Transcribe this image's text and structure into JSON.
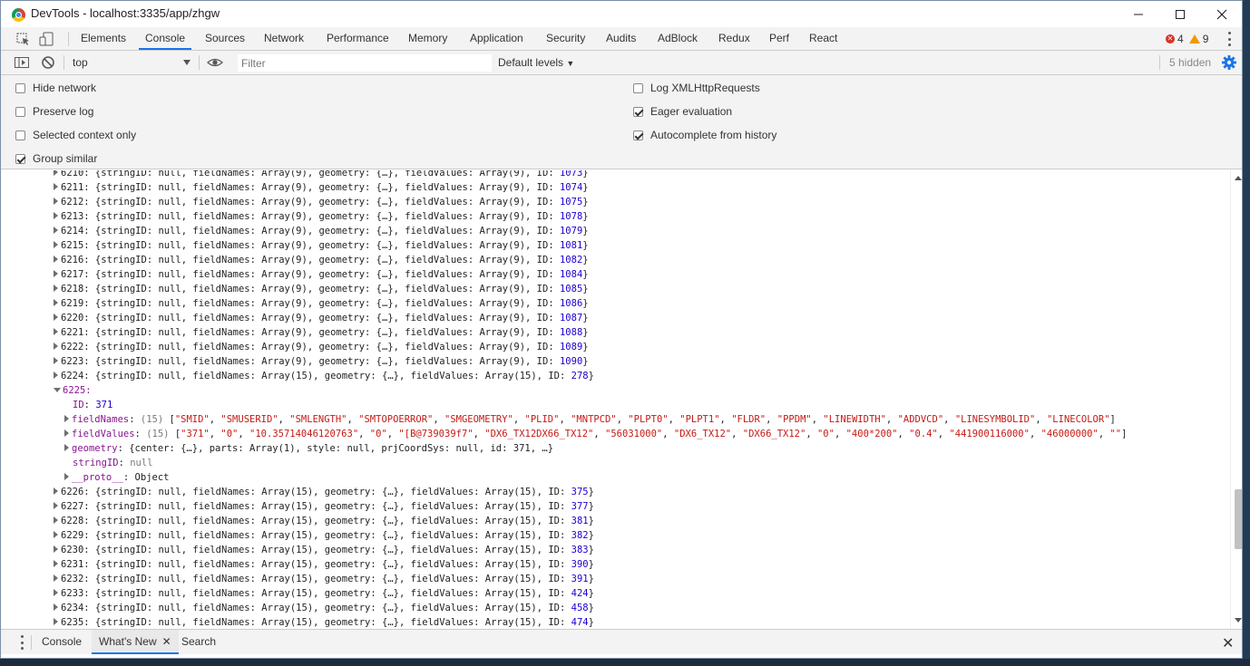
{
  "window": {
    "title": "DevTools - localhost:3335/app/zhgw",
    "controls": [
      "minimize-icon",
      "maximize-icon",
      "close-icon"
    ]
  },
  "tabs": [
    "Elements",
    "Console",
    "Sources",
    "Network",
    "Performance",
    "Memory",
    "Application",
    "Security",
    "Audits",
    "AdBlock",
    "Redux",
    "Perf",
    "React"
  ],
  "active_tab": "Console",
  "counts": {
    "errors": "4",
    "warnings": "9"
  },
  "toolbar": {
    "context": "top",
    "filter_placeholder": "Filter",
    "levels": "Default levels",
    "hidden": "5 hidden"
  },
  "settings": {
    "left": [
      {
        "label": "Hide network",
        "checked": false
      },
      {
        "label": "Preserve log",
        "checked": false
      },
      {
        "label": "Selected context only",
        "checked": false
      },
      {
        "label": "Group similar",
        "checked": true
      }
    ],
    "right": [
      {
        "label": "Log XMLHttpRequests",
        "checked": false
      },
      {
        "label": "Eager evaluation",
        "checked": true
      },
      {
        "label": "Autocomplete from history",
        "checked": true
      }
    ]
  },
  "console": {
    "rows_9": [
      {
        "idx": "6210",
        "id": "1073"
      },
      {
        "idx": "6211",
        "id": "1074"
      },
      {
        "idx": "6212",
        "id": "1075"
      },
      {
        "idx": "6213",
        "id": "1078"
      },
      {
        "idx": "6214",
        "id": "1079"
      },
      {
        "idx": "6215",
        "id": "1081"
      },
      {
        "idx": "6216",
        "id": "1082"
      },
      {
        "idx": "6217",
        "id": "1084"
      },
      {
        "idx": "6218",
        "id": "1085"
      },
      {
        "idx": "6219",
        "id": "1086"
      },
      {
        "idx": "6220",
        "id": "1087"
      },
      {
        "idx": "6221",
        "id": "1088"
      },
      {
        "idx": "6222",
        "id": "1089"
      },
      {
        "idx": "6223",
        "id": "1090"
      }
    ],
    "row_6224": {
      "idx": "6224",
      "id": "278"
    },
    "expanded": {
      "idx": "6225",
      "id": "371",
      "fieldNames": [
        "SMID",
        "SMUSERID",
        "SMLENGTH",
        "SMTOPOERROR",
        "SMGEOMETRY",
        "PLID",
        "MNTPCD",
        "PLPT0",
        "PLPT1",
        "FLDR",
        "PPDM",
        "LINEWIDTH",
        "ADDVCD",
        "LINESYMBOLID",
        "LINECOLOR"
      ],
      "fieldValues": [
        "371",
        "0",
        "10.35714046120763",
        "0",
        "[B@739039f7",
        "DX6_TX12DX66_TX12",
        "56031000",
        "DX6_TX12",
        "DX66_TX12",
        "0",
        "400*200",
        "0.4",
        "441900116000",
        "46000000",
        ""
      ],
      "count": "15",
      "geometry_text": "{center: {…}, parts: Array(1), style: null, prjCoordSys: null, id: 371, …}",
      "stringID": "null",
      "proto": "Object"
    },
    "rows_15": [
      {
        "idx": "6226",
        "id": "375"
      },
      {
        "idx": "6227",
        "id": "377"
      },
      {
        "idx": "6228",
        "id": "381"
      },
      {
        "idx": "6229",
        "id": "382"
      },
      {
        "idx": "6230",
        "id": "383"
      },
      {
        "idx": "6231",
        "id": "390"
      },
      {
        "idx": "6232",
        "id": "391"
      },
      {
        "idx": "6233",
        "id": "424"
      },
      {
        "idx": "6234",
        "id": "458"
      },
      {
        "idx": "6235",
        "id": "474"
      }
    ]
  },
  "drawer": {
    "tabs": [
      "Console",
      "What's New",
      "Search"
    ],
    "active": "What's New"
  }
}
